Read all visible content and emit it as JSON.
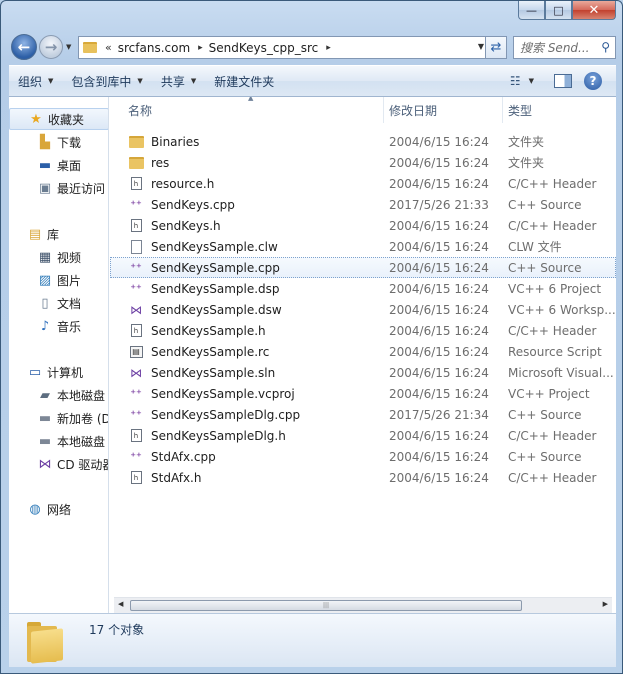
{
  "window": {
    "caption_buttons": {
      "minimize": "—",
      "maximize": "□",
      "close": "✕"
    }
  },
  "address": {
    "chevron": "«",
    "segments": [
      "srcfans.com",
      "SendKeys_cpp_src"
    ],
    "separator": "▸"
  },
  "search": {
    "placeholder": "搜索 Send..."
  },
  "toolbar": {
    "organize": "组织",
    "include_in_library": "包含到库中",
    "share": "共享",
    "new_folder": "新建文件夹"
  },
  "sidebar": {
    "favorites": "收藏夹",
    "fav_items": [
      "下载",
      "桌面",
      "最近访问"
    ],
    "libraries": "库",
    "lib_items": [
      "视频",
      "图片",
      "文档",
      "音乐"
    ],
    "computer": "计算机",
    "comp_items": [
      "本地磁盘",
      "新加卷 (D",
      "本地磁盘",
      "CD 驱动器"
    ],
    "network": "网络"
  },
  "columns": {
    "name": "名称",
    "date": "修改日期",
    "type": "类型"
  },
  "files": [
    {
      "name": "Binaries",
      "date": "2004/6/15 16:24",
      "type": "文件夹",
      "icon": "folder-icon"
    },
    {
      "name": "res",
      "date": "2004/6/15 16:24",
      "type": "文件夹",
      "icon": "folder-icon"
    },
    {
      "name": "resource.h",
      "date": "2004/6/15 16:24",
      "type": "C/C++ Header",
      "icon": "header-file-icon"
    },
    {
      "name": "SendKeys.cpp",
      "date": "2017/5/26 21:33",
      "type": "C++ Source",
      "icon": "cpp-file-icon"
    },
    {
      "name": "SendKeys.h",
      "date": "2004/6/15 16:24",
      "type": "C/C++ Header",
      "icon": "header-file-icon"
    },
    {
      "name": "SendKeysSample.clw",
      "date": "2004/6/15 16:24",
      "type": "CLW 文件",
      "icon": "generic-file-icon"
    },
    {
      "name": "SendKeysSample.cpp",
      "date": "2004/6/15 16:24",
      "type": "C++ Source",
      "icon": "cpp-file-icon"
    },
    {
      "name": "SendKeysSample.dsp",
      "date": "2004/6/15 16:24",
      "type": "VC++ 6 Project",
      "icon": "cpp-file-icon"
    },
    {
      "name": "SendKeysSample.dsw",
      "date": "2004/6/15 16:24",
      "type": "VC++ 6 Worksp...",
      "icon": "vs-solution-icon"
    },
    {
      "name": "SendKeysSample.h",
      "date": "2004/6/15 16:24",
      "type": "C/C++ Header",
      "icon": "header-file-icon"
    },
    {
      "name": "SendKeysSample.rc",
      "date": "2004/6/15 16:24",
      "type": "Resource Script",
      "icon": "resource-file-icon"
    },
    {
      "name": "SendKeysSample.sln",
      "date": "2004/6/15 16:24",
      "type": "Microsoft Visual...",
      "icon": "vs-solution-icon"
    },
    {
      "name": "SendKeysSample.vcproj",
      "date": "2004/6/15 16:24",
      "type": "VC++ Project",
      "icon": "cpp-file-icon"
    },
    {
      "name": "SendKeysSampleDlg.cpp",
      "date": "2017/5/26 21:34",
      "type": "C++ Source",
      "icon": "cpp-file-icon"
    },
    {
      "name": "SendKeysSampleDlg.h",
      "date": "2004/6/15 16:24",
      "type": "C/C++ Header",
      "icon": "header-file-icon"
    },
    {
      "name": "StdAfx.cpp",
      "date": "2004/6/15 16:24",
      "type": "C++ Source",
      "icon": "cpp-file-icon"
    },
    {
      "name": "StdAfx.h",
      "date": "2004/6/15 16:24",
      "type": "C/C++ Header",
      "icon": "header-file-icon"
    }
  ],
  "selected_file": "SendKeysSample.cpp",
  "status": {
    "item_count": "17 个对象"
  },
  "colors": {
    "accent": "#1e395b",
    "selection": "#7da2ce"
  }
}
